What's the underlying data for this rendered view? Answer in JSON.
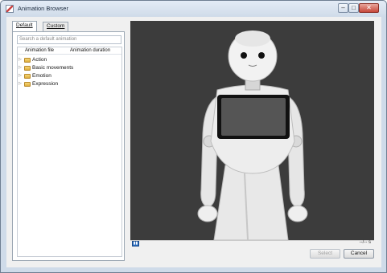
{
  "window": {
    "title": "Animation Browser",
    "controls": {
      "minimize": "–",
      "maximize": "□",
      "close": "✕"
    }
  },
  "tabs": [
    {
      "label": "Default",
      "active": true
    },
    {
      "label": "Custom",
      "active": false
    }
  ],
  "search": {
    "placeholder": "Search a default animation"
  },
  "tree": {
    "columns": [
      "Animation file",
      "Animation duration"
    ],
    "items": [
      {
        "label": "Action"
      },
      {
        "label": "Basic movements"
      },
      {
        "label": "Emotion"
      },
      {
        "label": "Expression"
      }
    ]
  },
  "playback": {
    "time": "--/-- s"
  },
  "buttons": {
    "select": "Select",
    "cancel": "Cancel"
  },
  "colors": {
    "viewport": "#3c3c3c",
    "folder": "#f6d77a",
    "play": "#2d6fc2"
  },
  "icons": {
    "app": "app-icon",
    "folder": "folder-icon",
    "expand": "chevron-right-icon",
    "play": "play-icon"
  }
}
